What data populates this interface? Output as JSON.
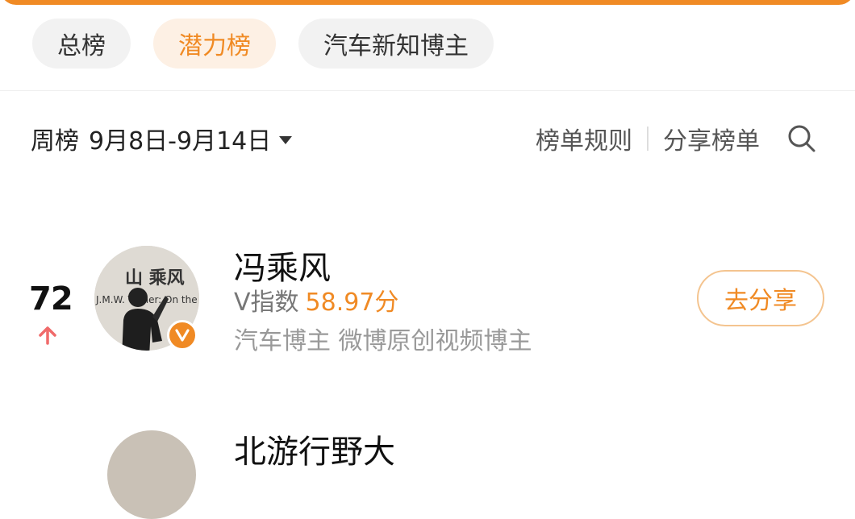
{
  "tabs": [
    {
      "label": "总榜",
      "active": false
    },
    {
      "label": "潜力榜",
      "active": true
    },
    {
      "label": "汽车新知博主",
      "active": false
    }
  ],
  "filter": {
    "period_label": "周榜",
    "date_range": "9月8日-9月14日"
  },
  "actions": {
    "rules_label": "榜单规则",
    "share_list_label": "分享榜单"
  },
  "entries": [
    {
      "rank": "72",
      "trend": "up",
      "name": "冯乘风",
      "v_index_label": "V指数",
      "v_index_value": "58.97分",
      "tags": "汽车博主 微博原创视频博主",
      "share_button": "去分享",
      "avatar_text_1": "山 乘风",
      "avatar_text_2": "J.M.W. Turner: On the"
    },
    {
      "name": "北游行野大"
    }
  ],
  "colors": {
    "accent": "#f08a24",
    "tab_active_bg": "#fdf0e4",
    "trend_up": "#f06a6a"
  },
  "icons": {
    "search": "search-icon",
    "dropdown": "caret-down-icon",
    "trend": "arrow-up-icon",
    "verified": "verified-v-icon"
  }
}
